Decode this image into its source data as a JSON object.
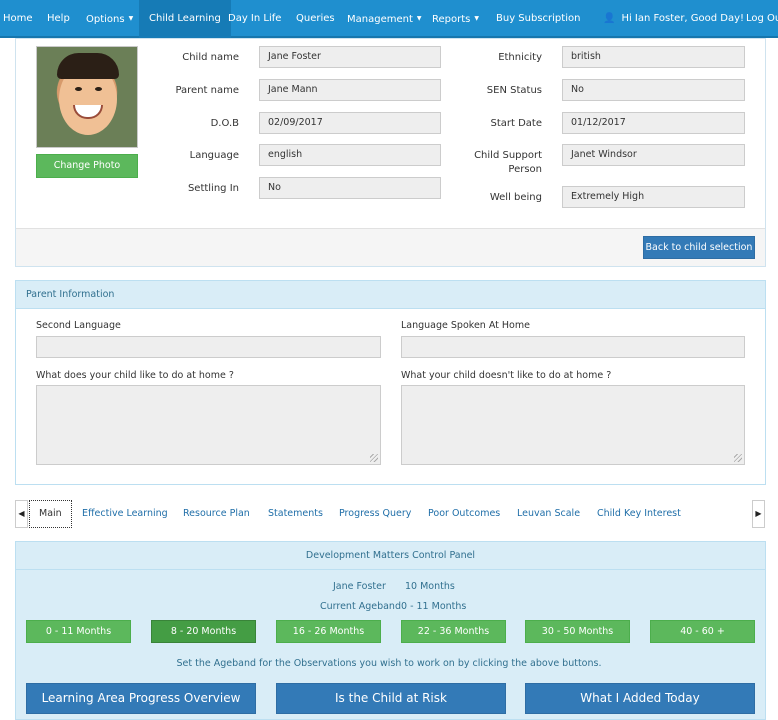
{
  "nav": {
    "home": "Home",
    "help": "Help",
    "options": "Options",
    "child_learning": "Child Learning",
    "day_in_life": "Day In Life",
    "queries": "Queries",
    "management": "Management",
    "reports": "Reports",
    "buy_subscription": "Buy Subscription",
    "greeting": "Hi Ian Foster, Good Day!",
    "logout": "Log Out",
    "caret_glyph": "▼",
    "user_glyph": "👤"
  },
  "child": {
    "change_photo": "Change Photo",
    "labels": {
      "child_name": "Child name",
      "parent_name": "Parent name",
      "dob": "D.O.B",
      "language": "Language",
      "settling_in": "Settling In",
      "ethnicity": "Ethnicity",
      "sen_status": "SEN Status",
      "start_date": "Start Date",
      "support_line1": "Child Support",
      "support_line2": "Person",
      "well_being": "Well being"
    },
    "values": {
      "child_name": "Jane Foster",
      "parent_name": "Jane Mann",
      "dob": "02/09/2017",
      "language": "english",
      "settling_in": "No",
      "ethnicity": "british",
      "sen_status": "No",
      "start_date": "01/12/2017",
      "support_person": "Janet Windsor",
      "well_being": "Extremely High"
    },
    "back_button": "Back to child selection"
  },
  "parent_info": {
    "heading": "Parent Information",
    "second_language": "Second Language",
    "language_home": "Language Spoken At Home",
    "likes": "What does your child like to do at home ?",
    "dislikes": "What your child doesn't like to do at home ?"
  },
  "tabs": {
    "prev_glyph": "◀",
    "next_glyph": "▶",
    "items": [
      "Main",
      "Effective Learning",
      "Resource Plan",
      "Statements",
      "Progress Query",
      "Poor Outcomes",
      "Leuvan Scale",
      "Child Key Interest"
    ]
  },
  "dev": {
    "heading": "Development Matters Control Panel",
    "child_name": "Jane Foster",
    "age": "10 Months",
    "current_ageband_label": "Current Ageband",
    "current_ageband": "0 - 11 Months",
    "agebands": [
      "0 - 11 Months",
      "8 - 20 Months",
      "16 - 26 Months",
      "22 - 36 Months",
      "30 - 50 Months",
      "40 - 60 +"
    ],
    "selected_index": 1,
    "instruction": "Set the Ageband for the Observations you wish to work on by clicking the above buttons.",
    "buttons": [
      "Learning Area Progress Overview",
      "Is the Child at Risk",
      "What I Added Today"
    ]
  },
  "colors": {
    "nav_bg": "#1f8fcf",
    "primary": "#337ab7",
    "success": "#5cb85c",
    "info_bg": "#d9edf7",
    "info_text": "#31708f"
  }
}
